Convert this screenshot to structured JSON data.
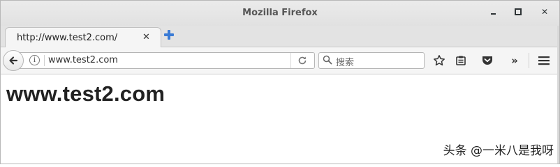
{
  "window": {
    "title": "Mozilla Firefox",
    "controls": {
      "minimize_icon": "minimize-icon",
      "maximize_icon": "maximize-icon",
      "close_glyph": "✕"
    }
  },
  "tabs": [
    {
      "label": "http://www.test2.com/",
      "close_glyph": "✕",
      "active": true
    }
  ],
  "new_tab_icon": "plus-icon",
  "navbar": {
    "url": "www.test2.com",
    "info_glyph": "i",
    "search_placeholder": "搜索",
    "overflow_glyph": "»"
  },
  "page": {
    "heading": "www.test2.com"
  },
  "watermark": {
    "text": "头条 @一米八是我呀"
  },
  "colors": {
    "newtab_plus": "#3a7bd5",
    "titlebar": "#e6e6e6",
    "toolbar": "#f5f5f5"
  }
}
